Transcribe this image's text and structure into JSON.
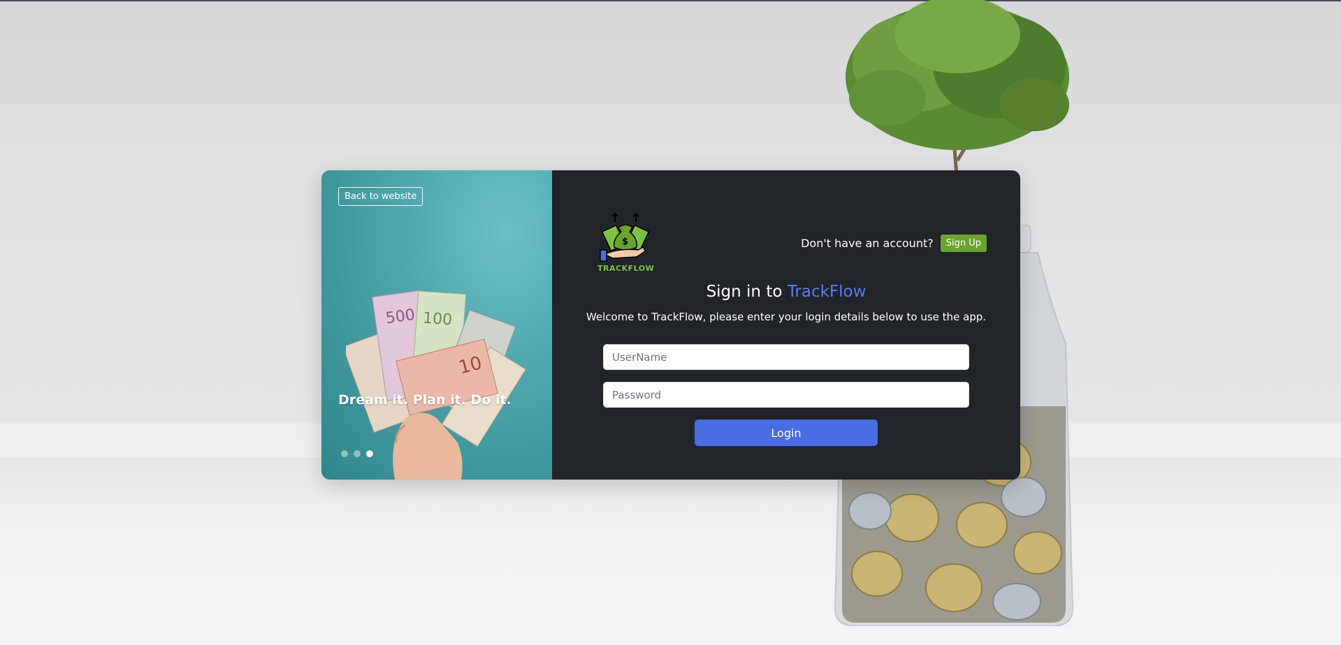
{
  "hero": {
    "back_label": "Back to website",
    "caption": "Dream it. Plan it. Do it.",
    "slide_count": 3,
    "active_slide": 3
  },
  "brand": {
    "logo_text": "TRACKFLOW",
    "accent_color": "#5b7cf0",
    "logo_color": "#7ec245"
  },
  "header": {
    "account_question": "Don't have an account?",
    "signup_label": "Sign Up"
  },
  "form": {
    "title_prefix": "Sign in to ",
    "title_brand": "TrackFlow",
    "subtitle": "Welcome to TrackFlow, please enter your login details below to use the app.",
    "username_placeholder": "UserName",
    "password_placeholder": "Password",
    "login_label": "Login"
  },
  "colors": {
    "signup_button": "#6aa32e",
    "login_button": "#4a6de5",
    "panel_dark": "#212429"
  }
}
